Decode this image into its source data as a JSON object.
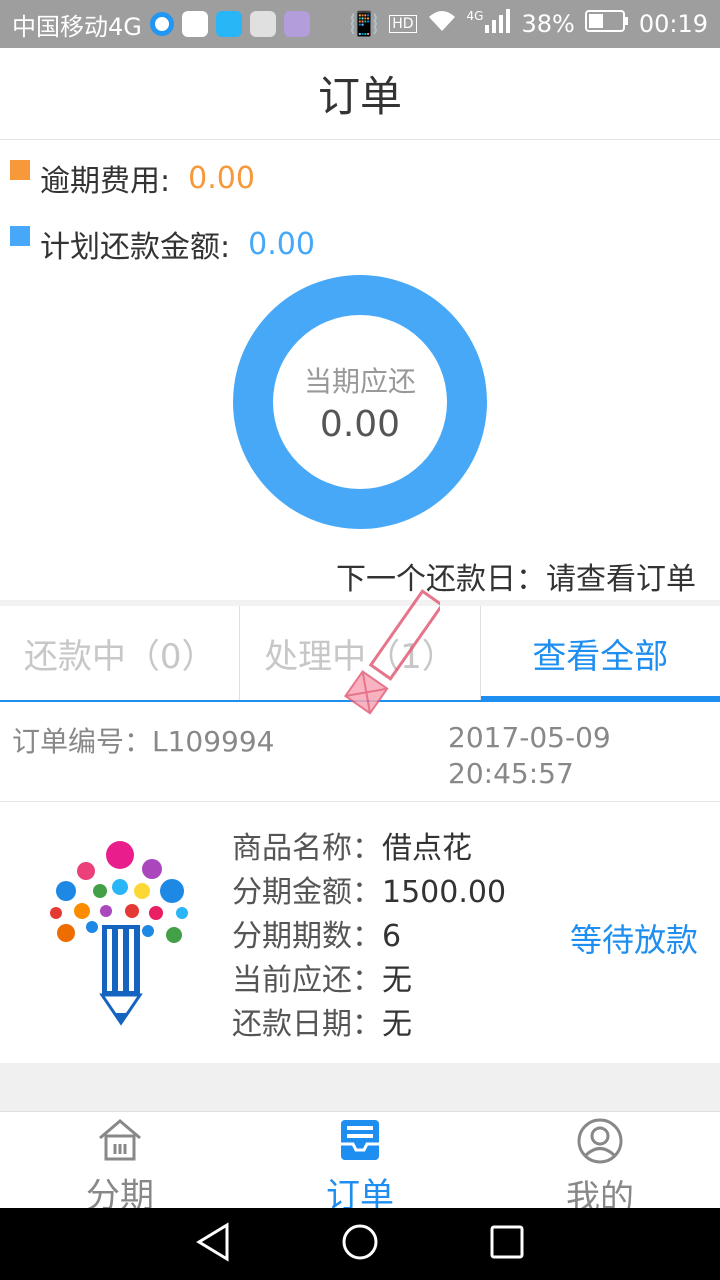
{
  "status_bar": {
    "carrier": "中国移动4G",
    "battery": "38%",
    "time": "00:19",
    "network_badge": "4G",
    "hd_badge": "HD"
  },
  "header": {
    "title": "订单"
  },
  "legend": {
    "overdue": {
      "label": "逾期费用:",
      "value": "0.00",
      "color": "#f7983a"
    },
    "planned": {
      "label": "计划还款金额:",
      "value": "0.00",
      "color": "#46a8f7"
    }
  },
  "donut": {
    "label": "当期应还",
    "amount": "0.00",
    "color": "#46a8f7"
  },
  "next_payment": "下一个还款日：请查看订单",
  "tabs": [
    {
      "label": "还款中（0）"
    },
    {
      "label": "处理中（1）"
    },
    {
      "label": "查看全部"
    }
  ],
  "order": {
    "number": "订单编号：L109994",
    "date": "2017-05-09",
    "time": "20:45:57",
    "fields": [
      {
        "label": "商品名称：",
        "value": "借点花"
      },
      {
        "label": "分期金额：",
        "value": "1500.00"
      },
      {
        "label": "分期期数：",
        "value": "6"
      },
      {
        "label": "当前应还：",
        "value": "无"
      },
      {
        "label": "还款日期：",
        "value": "无"
      }
    ],
    "status": "等待放款"
  },
  "bottom_nav": [
    {
      "label": "分期",
      "icon": "home-icon"
    },
    {
      "label": "订单",
      "icon": "inbox-icon"
    },
    {
      "label": "我的",
      "icon": "user-icon"
    }
  ],
  "accent_color": "#1e8ff0"
}
